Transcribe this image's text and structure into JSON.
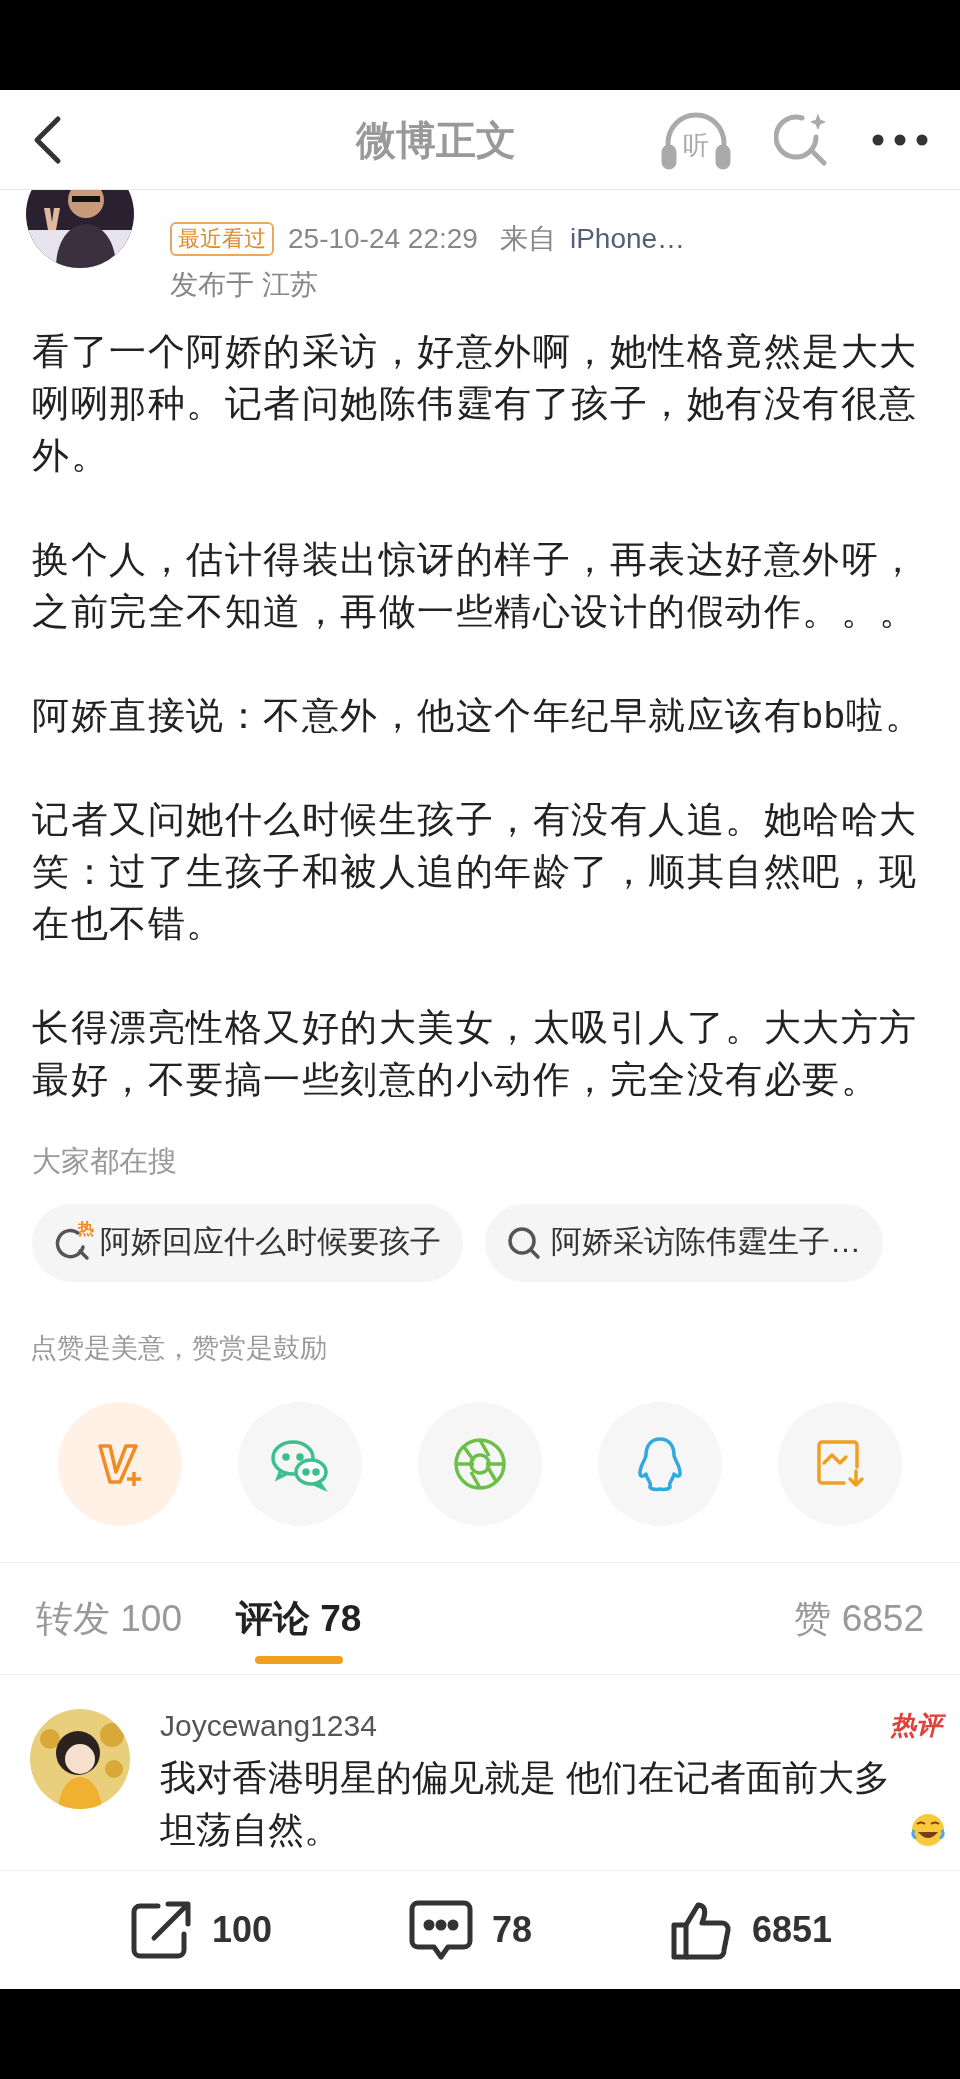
{
  "header": {
    "title": "微博正文",
    "listen_label": "听"
  },
  "author": {
    "badge": "最近看过",
    "time": "25-10-24 22:29",
    "source_prefix": "来自",
    "source": "iPhone…",
    "location": "发布于 江苏"
  },
  "paragraphs": [
    "看了一个阿娇的采访，好意外啊，她性格竟然是大大咧咧那种。记者问她陈伟霆有了孩子，她有没有很意外。",
    "换个人，估计得装出惊讶的样子，再表达好意外呀，之前完全不知道，再做一些精心设计的假动作。。。",
    "阿娇直接说：不意外，他这个年纪早就应该有bb啦。",
    "记者又问她什么时候生孩子，有没有人追。她哈哈大笑：过了生孩子和被人追的年龄了，顺其自然吧，现在也不错。",
    "长得漂亮性格又好的大美女，太吸引人了。大大方方最好，不要搞一些刻意的小动作，完全没有必要。"
  ],
  "trending": {
    "title": "大家都在搜",
    "items": [
      {
        "text": "阿娇回应什么时候要孩子",
        "hot": true,
        "hot_label": "热"
      },
      {
        "text": "阿娇采访陈伟霆生子…",
        "hot": false
      }
    ]
  },
  "reward": {
    "text": "点赞是美意，赞赏是鼓励"
  },
  "share_targets": [
    {
      "kind": "vplus",
      "selected": true
    },
    {
      "kind": "wechat",
      "selected": false
    },
    {
      "kind": "moments",
      "selected": false
    },
    {
      "kind": "qq",
      "selected": false
    },
    {
      "kind": "save_image",
      "selected": false
    }
  ],
  "tabs": [
    {
      "label": "转发",
      "count": "100",
      "selected": false
    },
    {
      "label": "评论",
      "count": "78",
      "selected": true
    },
    {
      "label": "赞",
      "count": "6852",
      "selected": false
    }
  ],
  "comment": {
    "user": "Joycewang1234",
    "badge": "热评",
    "text": "我对香港明星的偏见就是 他们在记者面前大多坦荡自然。"
  },
  "bottom_bar": [
    {
      "kind": "repost",
      "count": "100"
    },
    {
      "kind": "comment",
      "count": "78"
    },
    {
      "kind": "like",
      "count": "6851"
    }
  ]
}
